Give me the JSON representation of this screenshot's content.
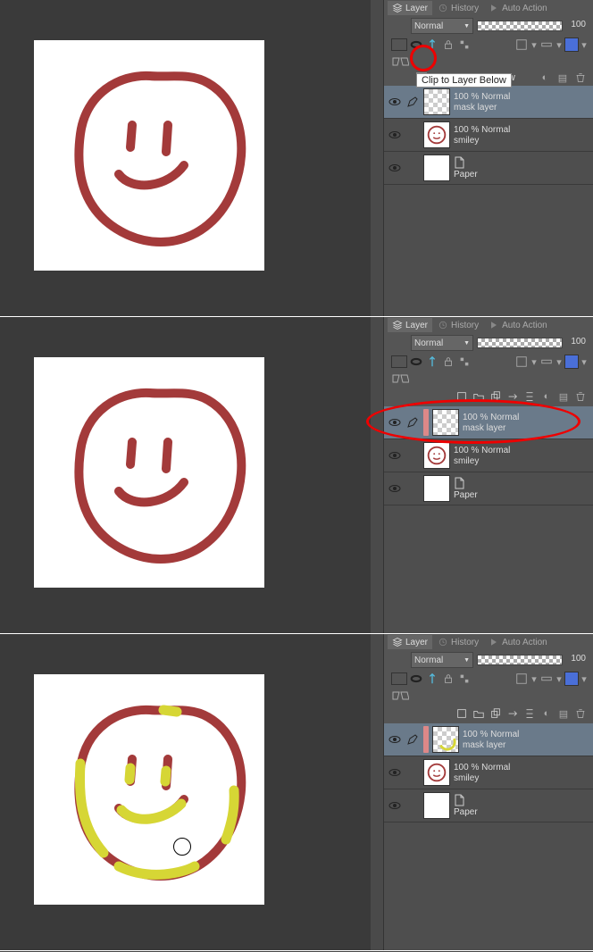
{
  "tabs": {
    "layer": "Layer",
    "history": "History",
    "auto_action": "Auto Action"
  },
  "blend": {
    "mode": "Normal",
    "opacity": "100"
  },
  "clip_label": "Clip to Layer Below",
  "layers": {
    "mask": {
      "info": "100 % Normal",
      "name": "mask layer"
    },
    "smiley": {
      "info": "100 % Normal",
      "name": "smiley"
    },
    "paper": {
      "name": "Paper"
    }
  },
  "icons": {
    "layer": "layer-stack-icon",
    "history": "history-icon",
    "action": "auto-action-icon",
    "eye": "eye-icon",
    "pen": "pen-icon"
  },
  "colors": {
    "smiley_stroke": "#a33a3a",
    "highlight_yellow": "#d6d635",
    "annotation_red": "#e00000",
    "swatch_blue": "#4a6fd8"
  }
}
